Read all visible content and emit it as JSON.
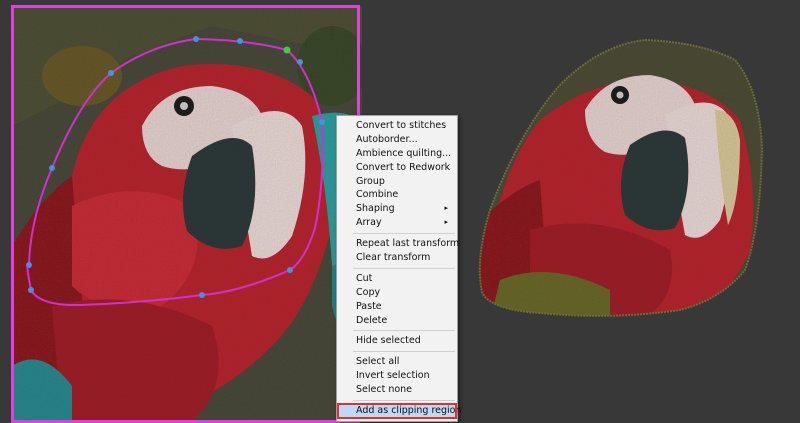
{
  "context_menu": {
    "items": [
      {
        "label": "Convert to stitches"
      },
      {
        "label": "Autoborder..."
      },
      {
        "label": "Ambience quilting..."
      },
      {
        "label": "Convert to Redwork"
      },
      {
        "label": "Group"
      },
      {
        "label": "Combine"
      },
      {
        "label": "Shaping",
        "submenu_arrow": "▸"
      },
      {
        "label": "Array",
        "submenu_arrow": "▸"
      },
      {
        "label": "Repeat last transform"
      },
      {
        "label": "Clear transform"
      },
      {
        "label": "Cut"
      },
      {
        "label": "Copy"
      },
      {
        "label": "Paste"
      },
      {
        "label": "Delete"
      },
      {
        "label": "Hide selected"
      },
      {
        "label": "Select all"
      },
      {
        "label": "Invert selection"
      },
      {
        "label": "Select none"
      },
      {
        "label": "Add as clipping region"
      }
    ]
  },
  "colors": {
    "background": "#383838",
    "selection_frame": "#e040e0",
    "clip_path": "#d030d0",
    "handle": "#4a90e2",
    "active_handle": "#3ccf3c",
    "highlight_bg": "#bcd9f5",
    "highlight_border": "#e0302c"
  }
}
